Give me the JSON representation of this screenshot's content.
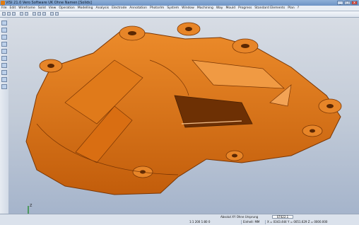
{
  "window": {
    "title": "VISI 21.0  Vero Software UK  Ohne Namen [Solids]",
    "buttons": [
      "_",
      "□",
      "x"
    ]
  },
  "menubar": {
    "items": [
      "File",
      "Edit",
      "Wireframe",
      "Solid",
      "View",
      "Operation",
      "Modelling",
      "Analysis",
      "Electrode",
      "Annotation",
      "Photorlm",
      "System",
      "Window",
      "Machining",
      "Way",
      "Mould",
      "Progress",
      "Standard Elements",
      "Plan",
      "?"
    ]
  },
  "colors": {
    "part": "#d86f13",
    "part_dark": "#8a3e05",
    "part_light": "#f2a04d",
    "viewport_top": "#d7dce4",
    "viewport_bottom": "#a5b4cb"
  },
  "statusbar": {
    "view_label": "Absolut XY Ohne Ursprung",
    "field_value": "ST422.1",
    "scale": "1:1 200 1:80 0",
    "units": "Einheit: MM",
    "coords": "X = 0343.444 Y = 0051.629 Z = 0000.000"
  },
  "axis": {
    "x_label": "X",
    "y_label": "Y",
    "z_label": "Z"
  }
}
